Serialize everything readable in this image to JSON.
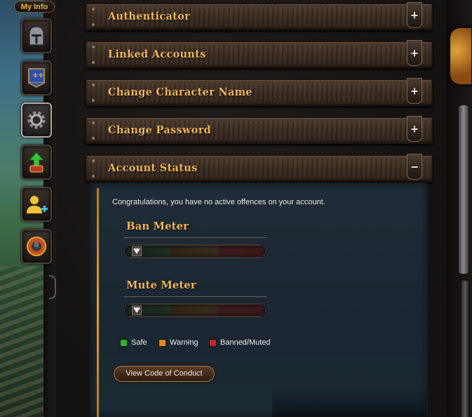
{
  "tab": {
    "label": "My Info"
  },
  "nav": [
    {
      "name": "helmet-icon",
      "label": ""
    },
    {
      "name": "banner-icon",
      "label": ""
    },
    {
      "name": "gear-icon",
      "label": ""
    },
    {
      "name": "upgrade-arrow-icon",
      "label": ""
    },
    {
      "name": "add-friend-icon",
      "label": ""
    },
    {
      "name": "hook-icon",
      "label": ""
    }
  ],
  "sections": [
    {
      "title": "Authenticator",
      "toggle": "+"
    },
    {
      "title": "Linked Accounts",
      "toggle": "+"
    },
    {
      "title": "Change Character Name",
      "toggle": "+"
    },
    {
      "title": "Change Password",
      "toggle": "+"
    },
    {
      "title": "Account Status",
      "toggle": "−"
    }
  ],
  "account_status": {
    "message": "Congratulations, you have no active offences on your account.",
    "ban_meter": {
      "title": "Ban Meter",
      "level": 0
    },
    "mute_meter": {
      "title": "Mute Meter",
      "level": 0
    },
    "legend": [
      {
        "label": "Safe",
        "color": "#2fb52f"
      },
      {
        "label": "Warning",
        "color": "#e0861c"
      },
      {
        "label": "Banned/Muted",
        "color": "#cc2222"
      }
    ],
    "conduct_button": "View Code of Conduct"
  }
}
